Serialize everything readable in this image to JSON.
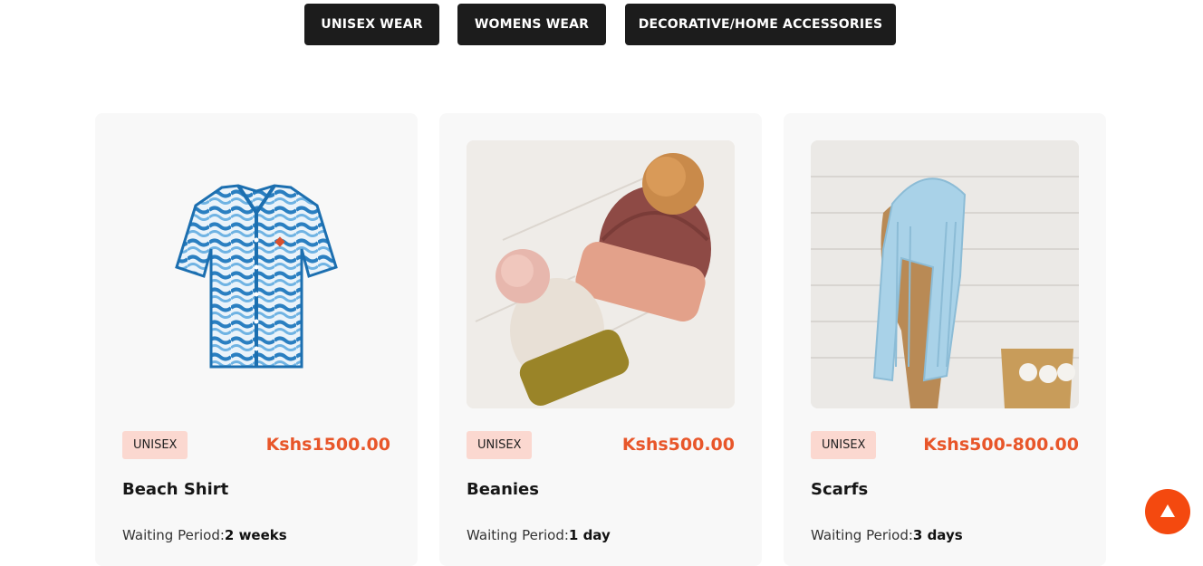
{
  "filters": [
    {
      "label": "UNISEX WEAR"
    },
    {
      "label": "WOMENS WEAR"
    },
    {
      "label": "DECORATIVE/HOME ACCESSORIES"
    }
  ],
  "products": [
    {
      "category": "UNISEX",
      "price": "Kshs1500.00",
      "name": "Beach Shirt",
      "waiting_label": "Waiting Period:",
      "waiting_value": "2 weeks"
    },
    {
      "category": "UNISEX",
      "price": "Kshs500.00",
      "name": "Beanies",
      "waiting_label": "Waiting Period:",
      "waiting_value": "1 day"
    },
    {
      "category": "UNISEX",
      "price": "Kshs500-800.00",
      "name": "Scarfs",
      "waiting_label": "Waiting Period:",
      "waiting_value": "3 days"
    }
  ],
  "colors": {
    "accent": "#e8562a",
    "button_bg": "#1c1c1c",
    "badge_bg": "#fbd8d0",
    "scroll_button": "#f4490f"
  },
  "icons": {
    "scroll_top": "triangle-up-icon"
  }
}
